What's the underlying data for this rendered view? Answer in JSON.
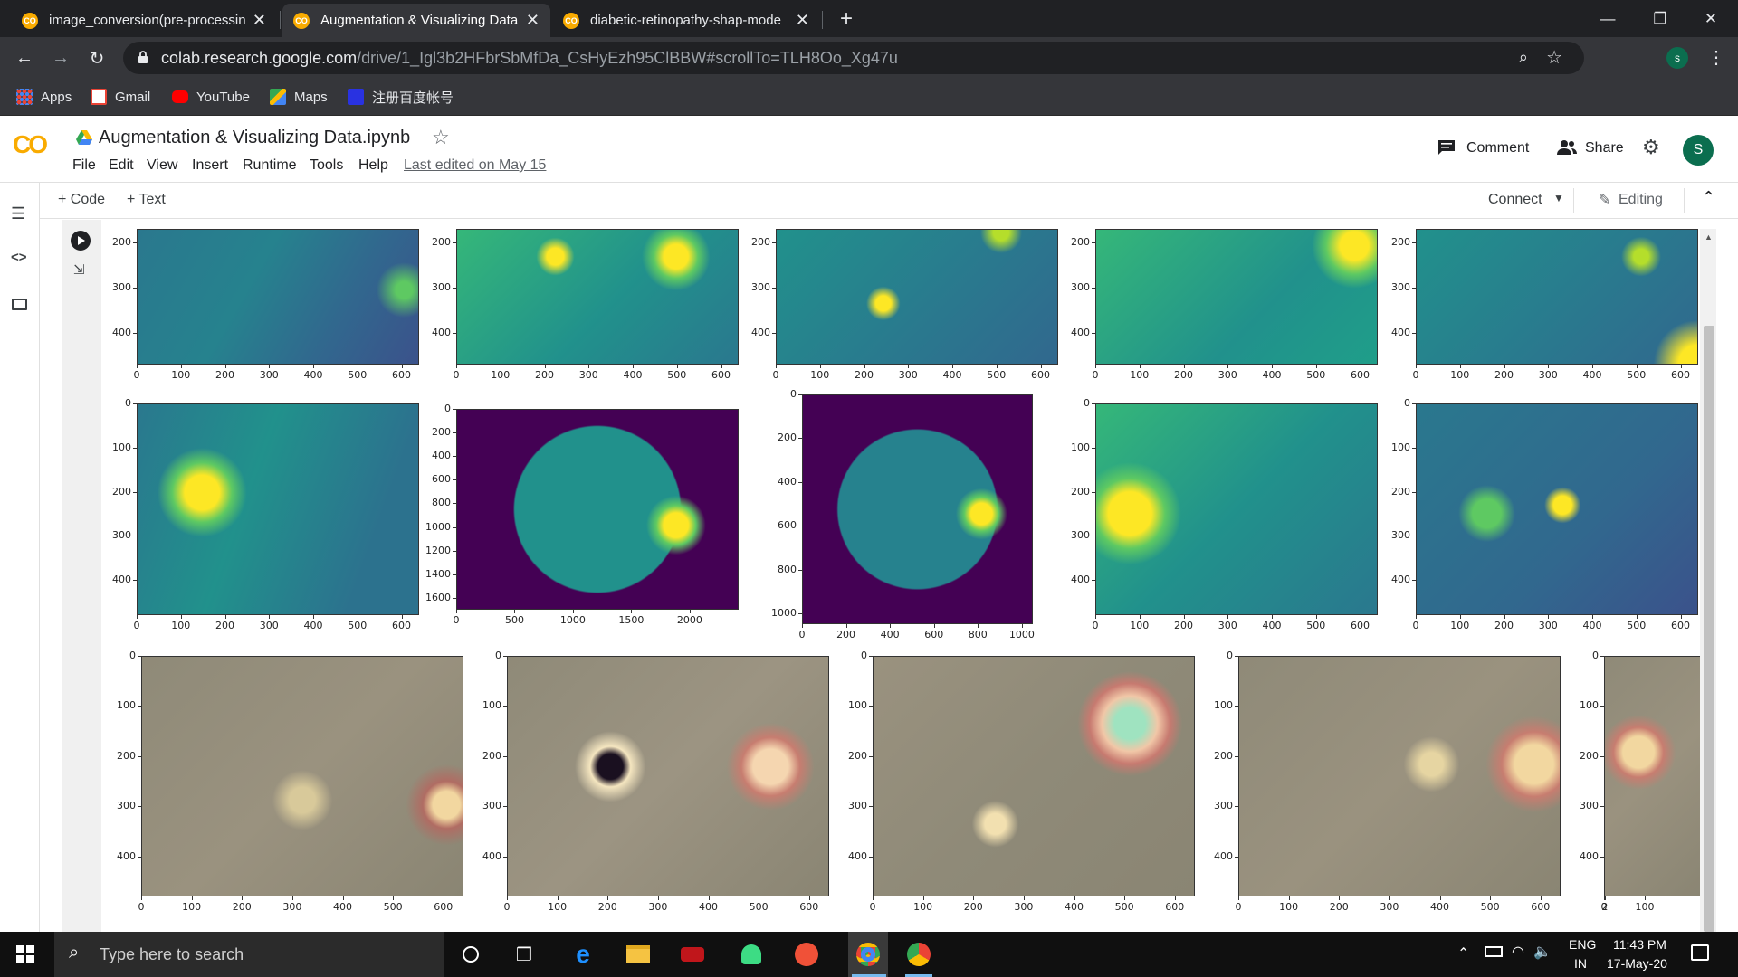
{
  "browser": {
    "tabs": [
      {
        "title": "image_conversion(pre-processing",
        "active": false
      },
      {
        "title": "Augmentation & Visualizing Data",
        "active": true
      },
      {
        "title": "diabetic-retinopathy-shap-mode",
        "active": false
      }
    ],
    "url_domain": "colab.research.google.com",
    "url_path": "/drive/1_Igl3b2HFbrSbMfDa_CsHyEzh95ClBBW#scrollTo=TLH8Oo_Xg47u",
    "profile_initial": "s",
    "bookmarks": [
      {
        "label": "Apps",
        "icon": "apps-grid-icon"
      },
      {
        "label": "Gmail",
        "icon": "gmail-icon"
      },
      {
        "label": "YouTube",
        "icon": "youtube-icon"
      },
      {
        "label": "Maps",
        "icon": "maps-icon"
      },
      {
        "label": "注册百度帐号",
        "icon": "baidu-icon"
      }
    ]
  },
  "colab": {
    "logo": "CO",
    "notebook_title": "Augmentation & Visualizing Data.ipynb",
    "menu": [
      "File",
      "Edit",
      "View",
      "Insert",
      "Runtime",
      "Tools",
      "Help"
    ],
    "last_edited": "Last edited on May 15",
    "comment_label": "Comment",
    "share_label": "Share",
    "avatar_initial": "S",
    "add_code_label": "+ Code",
    "add_text_label": "+ Text",
    "connect_label": "Connect",
    "editing_label": "Editing",
    "colors": {
      "accent": "#f9ab00",
      "avatar_bg": "#0b6e4f"
    }
  },
  "plots": {
    "row1_yticks": [
      "200",
      "300",
      "400"
    ],
    "row_xticks_600": [
      "0",
      "100",
      "200",
      "300",
      "400",
      "500",
      "600"
    ],
    "row2_yticks_400": [
      "0",
      "100",
      "200",
      "300",
      "400"
    ],
    "r2p2_yticks": [
      "0",
      "200",
      "400",
      "600",
      "800",
      "1000",
      "1200",
      "1400",
      "1600"
    ],
    "r2p2_xticks": [
      "0",
      "500",
      "1000",
      "1500",
      "2000"
    ],
    "r2p3_yticks": [
      "0",
      "200",
      "400",
      "600",
      "800",
      "1000"
    ],
    "r2p3_xticks": [
      "0",
      "200",
      "400",
      "600",
      "800",
      "1000"
    ],
    "r3_partial_xticks": [
      "0",
      "100",
      "2"
    ]
  },
  "taskbar": {
    "search_placeholder": "Type here to search",
    "lang_top": "ENG",
    "lang_bottom": "IN",
    "time": "11:43 PM",
    "date": "17-May-20"
  }
}
